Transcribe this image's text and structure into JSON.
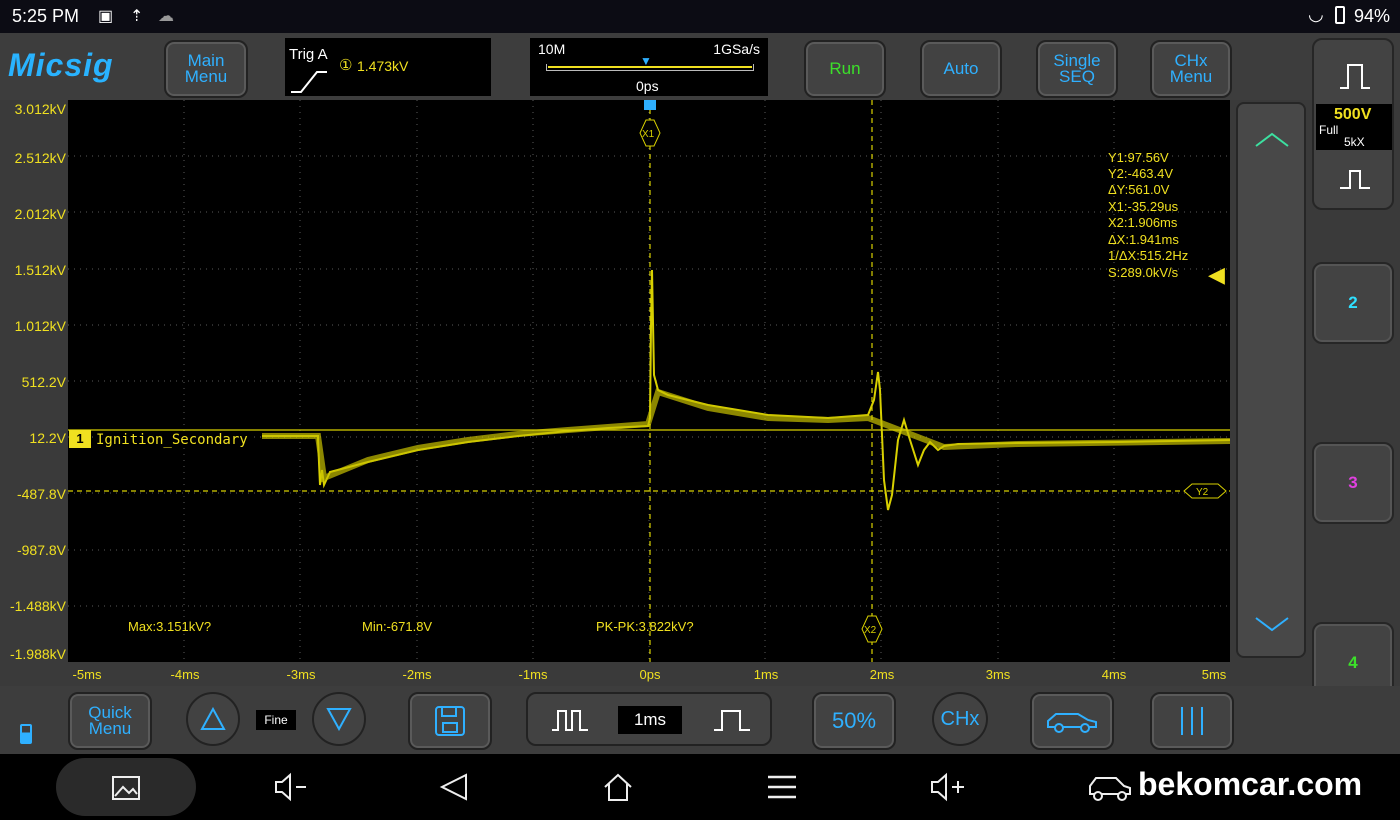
{
  "status": {
    "time": "5:25 PM",
    "battery": "94%"
  },
  "top": {
    "logo": "Micsig",
    "main_menu": "Main\nMenu",
    "trig_label": "Trig A",
    "trig_level": "1.473kV",
    "trig_channel_mark": "①",
    "memory_depth": "10M",
    "sample_rate": "1GSa/s",
    "horizontal_position": "0ps",
    "run": "Run",
    "auto": "Auto",
    "single_seq": "Single\nSEQ",
    "chx_menu": "CHx\nMenu"
  },
  "y_axis": [
    "3.012kV",
    "2.512kV",
    "2.012kV",
    "1.512kV",
    "1.012kV",
    "512.2V",
    "12.2V",
    "-487.8V",
    "-987.8V",
    "-1.488kV",
    "-1.988kV"
  ],
  "x_axis": [
    "-5ms",
    "-4ms",
    "-3ms",
    "-2ms",
    "-1ms",
    "0ps",
    "1ms",
    "2ms",
    "3ms",
    "4ms",
    "5ms"
  ],
  "channel": {
    "number": "1",
    "label": "Ignition_Secondary",
    "scale": "500V",
    "coupling": "Full",
    "probe": "5kX",
    "color": "#f0e020"
  },
  "cursors": {
    "readout": [
      "Y1:97.56V",
      "Y2:-463.4V",
      "ΔY:561.0V",
      "X1:-35.29us",
      "X2:1.906ms",
      "ΔX:1.941ms",
      "1/ΔX:515.2Hz",
      "S:289.0kV/s"
    ],
    "x1_tag": "X1",
    "x2_tag": "X2",
    "y2_tag": "Y2"
  },
  "measurements": {
    "max": "Max:3.151kV?",
    "min": "Min:-671.8V",
    "pkpk": "PK-PK:3.822kV?"
  },
  "right": {
    "ch2": "2",
    "ch3": "3",
    "ch4": "4"
  },
  "bottom": {
    "quick_menu": "Quick\nMenu",
    "fine": "Fine",
    "timebase": "1ms",
    "fifty": "50%",
    "chx": "CHx"
  },
  "watermark": "bekomcar.com"
}
